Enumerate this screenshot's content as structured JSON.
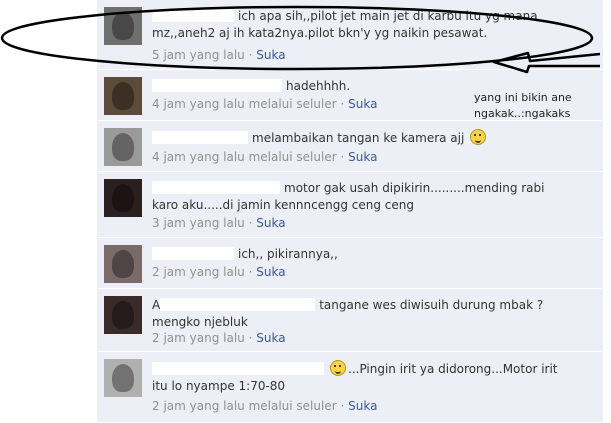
{
  "comments": [
    {
      "text": "ich apa sih,,pilot jet main jet di karbu itu yg mana",
      "text2": "mz,,aneh2 aj ih kata2nya.pilot bkn'y yg naikin pesawat.",
      "time": "5 jam yang lalu",
      "like": "Suka"
    },
    {
      "text": "hadehhhh.",
      "time": "4 jam yang lalu melalui seluler",
      "like": "Suka"
    },
    {
      "text": "melambaikan tangan ke kamera ajj",
      "time": "4 jam yang lalu melalui seluler",
      "like": "Suka"
    },
    {
      "text": "motor gak usah dipikirin.........mending rabi",
      "text2": "karo aku.....di jamin kennncengg ceng ceng",
      "time": "3 jam yang lalu",
      "like": "Suka"
    },
    {
      "text": "ich,, pikirannya,,",
      "time": "2 jam yang lalu",
      "like": "Suka"
    },
    {
      "name_initial": "A",
      "text": "tangane wes diwisuih durung mbak ?",
      "text2": "mengko njebluk",
      "time": "2 jam yang lalu",
      "like": "Suka"
    },
    {
      "text": "...Pingin irit ya didorong...Motor irit",
      "text2": "itu lo nyampe 1:70-80",
      "time": "2 jam yang lalu melalui seluler",
      "like": "Suka"
    }
  ],
  "annotation": {
    "line1": "yang ini bikin ane",
    "line2": "ngakak..:ngakaks"
  },
  "colors": {
    "comment_bg": "#eceff5",
    "link": "#3b5998",
    "meta": "#909090"
  },
  "icons": {
    "smiley": "smiley-icon",
    "arrow": "arrow-icon"
  }
}
